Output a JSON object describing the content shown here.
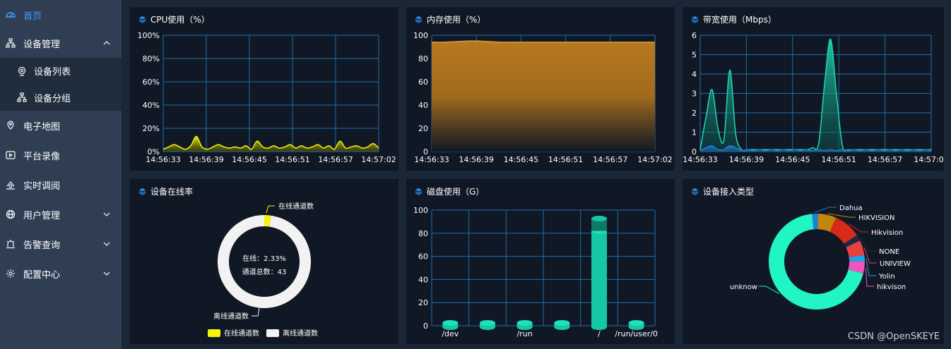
{
  "sidebar": {
    "items": [
      {
        "label": "首页",
        "icon": "dashboard-icon"
      },
      {
        "label": "设备管理",
        "icon": "device-tree-icon"
      },
      {
        "label": "设备列表",
        "icon": "camera-icon"
      },
      {
        "label": "设备分组",
        "icon": "group-tree-icon"
      },
      {
        "label": "电子地图",
        "icon": "map-icon"
      },
      {
        "label": "平台录像",
        "icon": "video-icon"
      },
      {
        "label": "实时调阅",
        "icon": "live-view-icon"
      },
      {
        "label": "用户管理",
        "icon": "globe-icon"
      },
      {
        "label": "告警查询",
        "icon": "alarm-icon"
      },
      {
        "label": "配置中心",
        "icon": "gear-icon"
      }
    ]
  },
  "panels": {
    "cpu": {
      "title": "CPU使用（%）"
    },
    "mem": {
      "title": "内存使用（%）"
    },
    "net": {
      "title": "带宽使用（Mbps）"
    },
    "online": {
      "title": "设备在线率"
    },
    "disk": {
      "title": "磁盘使用（G）"
    },
    "access": {
      "title": "设备接入类型"
    }
  },
  "colors": {
    "accent": "#409eff",
    "teal": "#20d8b4",
    "yellow": "#f5f50a",
    "gold": "#c98825"
  },
  "chart_data": [
    {
      "id": "cpu",
      "type": "area",
      "x_ticks": [
        "14:56:33",
        "14:56:39",
        "14:56:45",
        "14:56:51",
        "14:56:57",
        "14:57:02"
      ],
      "y_ticks": [
        "0%",
        "20%",
        "40%",
        "60%",
        "80%",
        "100%"
      ],
      "ylim": [
        0,
        100
      ],
      "series": [
        {
          "values": [
            2,
            4,
            6,
            4,
            2,
            5,
            13,
            4,
            2,
            4,
            6,
            4,
            3,
            4,
            3,
            5,
            2,
            9,
            4,
            3,
            5,
            3,
            4,
            6,
            3,
            5,
            3,
            4,
            6,
            3,
            5,
            2,
            9,
            3,
            4,
            5,
            3,
            4,
            7,
            3
          ]
        }
      ]
    },
    {
      "id": "mem",
      "type": "area",
      "x_ticks": [
        "14:56:33",
        "14:56:39",
        "14:56:45",
        "14:56:51",
        "14:56:57",
        "14:57:02"
      ],
      "y_ticks": [
        "0",
        "20",
        "40",
        "60",
        "80",
        "100"
      ],
      "ylim": [
        0,
        100
      ],
      "series": [
        {
          "values": [
            94,
            94,
            94.5,
            95,
            95,
            94.5,
            94,
            94,
            94,
            94,
            94,
            94,
            94,
            94,
            94,
            94,
            94,
            94,
            94,
            94
          ]
        }
      ]
    },
    {
      "id": "net",
      "type": "area",
      "x_ticks": [
        "14:56:33",
        "14:56:39",
        "14:56:45",
        "14:56:51",
        "14:56:57",
        "14:57:02"
      ],
      "y_ticks": [
        "0",
        "1",
        "2",
        "3",
        "4",
        "5",
        "6"
      ],
      "ylim": [
        0,
        6
      ],
      "series": [
        {
          "values": [
            0.1,
            1.8,
            3.2,
            1.2,
            0.6,
            4.2,
            0.9,
            0.1,
            0.1,
            0.1,
            0.1,
            0.1,
            0.1,
            0.1,
            0.1,
            0.1,
            0.1,
            0.1,
            0.1,
            0.2,
            0.4,
            3.5,
            5.8,
            3.0,
            0.3,
            0.1,
            0.1,
            0.1,
            0.1,
            0.1,
            0.1,
            0.1,
            0.1,
            0.1,
            0.1,
            0.1,
            0.1,
            0.1,
            0.1,
            0.1
          ]
        },
        {
          "values": [
            0.05,
            0.2,
            0.3,
            0.1,
            0.1,
            0.3,
            0.2,
            0.05,
            0.1,
            0.05,
            0.1,
            0.05,
            0.1,
            0.05,
            0.1,
            0.05,
            0.1,
            0.05,
            0.1,
            0.05,
            0.1,
            0.05,
            0.1,
            0.05,
            0.1,
            0.05,
            0.1,
            0.05,
            0.1,
            0.05,
            0.1,
            0.05,
            0.1,
            0.05,
            0.1,
            0.05,
            0.1,
            0.05,
            0.1,
            0.05
          ]
        }
      ]
    },
    {
      "id": "online",
      "type": "pie",
      "center_text": [
        "在线：2.33%",
        "通道总数：43"
      ],
      "slices": [
        {
          "name": "在线通道数",
          "value": 2.33,
          "color": "#f5f50a"
        },
        {
          "name": "离线通道数",
          "value": 97.67,
          "color": "#f2f2f2"
        }
      ],
      "legend": "bottom"
    },
    {
      "id": "disk",
      "type": "bar",
      "categories": [
        "/dev",
        "",
        "/run",
        "",
        "/",
        "/run/user/0"
      ],
      "values": [
        1,
        1,
        1,
        1,
        82,
        0
      ],
      "y_ticks": [
        "0",
        "20",
        "40",
        "60",
        "80",
        "100"
      ],
      "ylim": [
        0,
        100
      ]
    },
    {
      "id": "access",
      "type": "pie",
      "slices": [
        {
          "name": "Dahua",
          "value": 2,
          "color": "#1e7ed8"
        },
        {
          "name": "HIKVISION",
          "value": 6,
          "color": "#c3860d"
        },
        {
          "name": "Hikvision",
          "value": 9,
          "color": "#d82a18"
        },
        {
          "name": "NONE",
          "value": 2,
          "color": "#1a2a4a"
        },
        {
          "name": "UNIVIEW",
          "value": 5,
          "color": "#e84040"
        },
        {
          "name": "Yolin",
          "value": 2,
          "color": "#1aa6e8"
        },
        {
          "name": "hikvison",
          "value": 4,
          "color": "#f055c0"
        },
        {
          "name": "unknow",
          "value": 68,
          "color": "#22f5c5"
        }
      ]
    }
  ],
  "watermark": "CSDN @OpenSKEYE"
}
